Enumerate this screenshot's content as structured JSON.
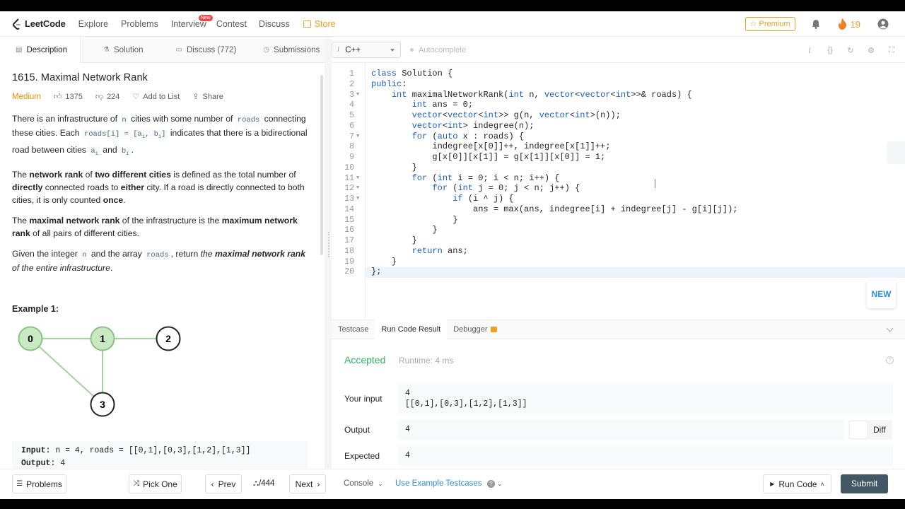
{
  "nav": {
    "logo": "LeetCode",
    "links": [
      "Explore",
      "Problems",
      "Interview",
      "Contest",
      "Discuss"
    ],
    "new_badge": "New",
    "store": "Store",
    "premium": "☆ Premium",
    "streak": "19"
  },
  "tabs": {
    "description": "Description",
    "solution": "Solution",
    "discuss": "Discuss (772)",
    "submissions": "Submissions"
  },
  "problem": {
    "title": "1615. Maximal Network Rank",
    "difficulty": "Medium",
    "likes": "1375",
    "dislikes": "224",
    "add_to_list": "Add to List",
    "share": "Share"
  },
  "description": {
    "p1_a": "There is an infrastructure of ",
    "p1_n": "n",
    "p1_b": " cities with some number of ",
    "p1_roads": "roads",
    "p1_c": " connecting these cities. Each ",
    "p1_roadsi": "roads[i] = [a",
    "p1_sub_i1": "i",
    "p1_comma": ", b",
    "p1_sub_i2": "i",
    "p1_close": "]",
    "p1_d": " indicates that there is a bidirectional road between cities ",
    "p1_ai": "a",
    "p1_ai_sub": "i",
    "p1_and": " and ",
    "p1_bi": "b",
    "p1_bi_sub": "i",
    "p1_end": ".",
    "p2_a": "The ",
    "p2_b": "network rank",
    "p2_c": " of ",
    "p2_d": "two different cities",
    "p2_e": " is defined as the total number of ",
    "p2_f": "directly",
    "p2_g": " connected roads to ",
    "p2_h": "either",
    "p2_i": " city. If a road is directly connected to both cities, it is only counted ",
    "p2_j": "once",
    "p2_k": ".",
    "p3_a": "The ",
    "p3_b": "maximal network rank",
    "p3_c": " of the infrastructure is the ",
    "p3_d": "maximum network rank",
    "p3_e": " of all pairs of different cities.",
    "p4_a": "Given the integer ",
    "p4_n": "n",
    "p4_b": " and the array ",
    "p4_roads": "roads",
    "p4_c": ", return ",
    "p4_d": "the ",
    "p4_e": "maximal network rank",
    "p4_f": " of the entire infrastructure",
    "p4_g": ".",
    "example_title": "Example 1:",
    "graph_nodes": [
      "0",
      "1",
      "2",
      "3"
    ],
    "ex_input_label": "Input:",
    "ex_input": " n = 4, roads = [[0,1],[0,3],[1,2],[1,3]]",
    "ex_output_label": "Output:",
    "ex_output": " 4"
  },
  "editor": {
    "language": "C++",
    "autocomplete": "Autocomplete",
    "lines": [
      "class Solution {",
      "public:",
      "    int maximalNetworkRank(int n, vector<vector<int>>& roads) {",
      "        int ans = 0;",
      "        vector<vector<int>> g(n, vector<int>(n));",
      "        vector<int> indegree(n);",
      "        for (auto x : roads) {",
      "            indegree[x[0]]++, indegree[x[1]]++;",
      "            g[x[0]][x[1]] = g[x[1]][x[0]] = 1;",
      "        }",
      "        for (int i = 0; i < n; i++) {",
      "            for (int j = 0; j < n; j++) {",
      "                if (i ^ j) {",
      "                    ans = max(ans, indegree[i] + indegree[j] - g[i][j]);",
      "                }",
      "            }",
      "        }",
      "        return ans;",
      "    }",
      "};"
    ],
    "new_button": "NEW"
  },
  "result": {
    "tabs": [
      "Testcase",
      "Run Code Result",
      "Debugger"
    ],
    "status": "Accepted",
    "runtime": "Runtime: 4 ms",
    "your_input_label": "Your input",
    "your_input_1": "4",
    "your_input_2": "[[0,1],[0,3],[1,2],[1,3]]",
    "output_label": "Output",
    "output": "4",
    "expected_label": "Expected",
    "expected": "4",
    "diff": "Diff"
  },
  "bottom": {
    "problems": "Problems",
    "pick_one": "Pick One",
    "prev": "Prev",
    "page": "/444",
    "next": "Next",
    "console": "Console",
    "use_example": "Use Example Testcases",
    "run_code": "Run Code",
    "submit": "Submit"
  },
  "colors": {
    "accent": "#f0a020",
    "accepted": "#2db55d",
    "medium": "#ef8d00",
    "keyword": "#1c5dc8",
    "submit": "#435865",
    "node_green": "#c9e8c3"
  }
}
